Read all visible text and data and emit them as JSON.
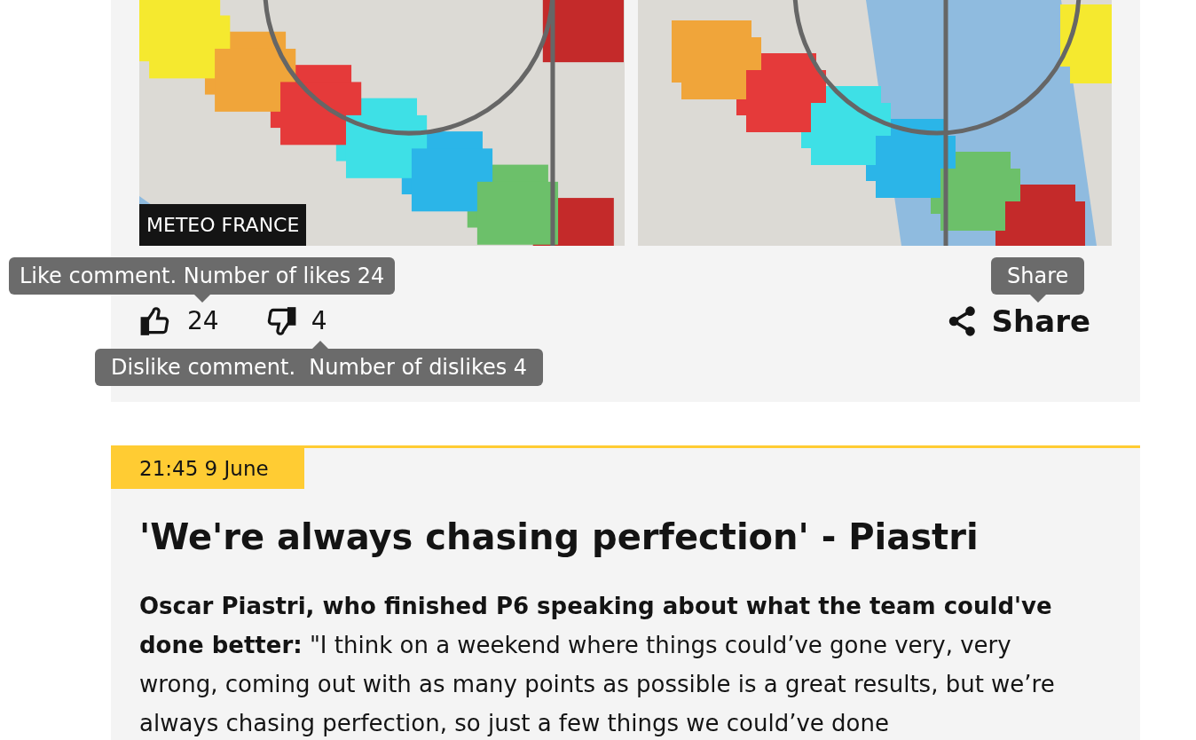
{
  "post_1": {
    "image_credit": "METEO FRANCE",
    "like": {
      "count": "24",
      "tooltip": "Like comment. Number of likes 24"
    },
    "dislike": {
      "count": "4",
      "tooltip": "Dislike comment.  Number of dislikes 4"
    },
    "share": {
      "label": "Share",
      "tooltip": "Share"
    }
  },
  "post_2": {
    "timestamp": "21:45 9 June",
    "headline": "'We're always chasing perfection' - Piastri",
    "body": "**Oscar Piastri, who finished P6 speaking about what the team could've done better:** \"I think on a weekend where things could’ve gone very, very wrong, coming out with as many points as possible is a great results, but we’re always chasing perfection, so just a few things we could’ve done"
  }
}
